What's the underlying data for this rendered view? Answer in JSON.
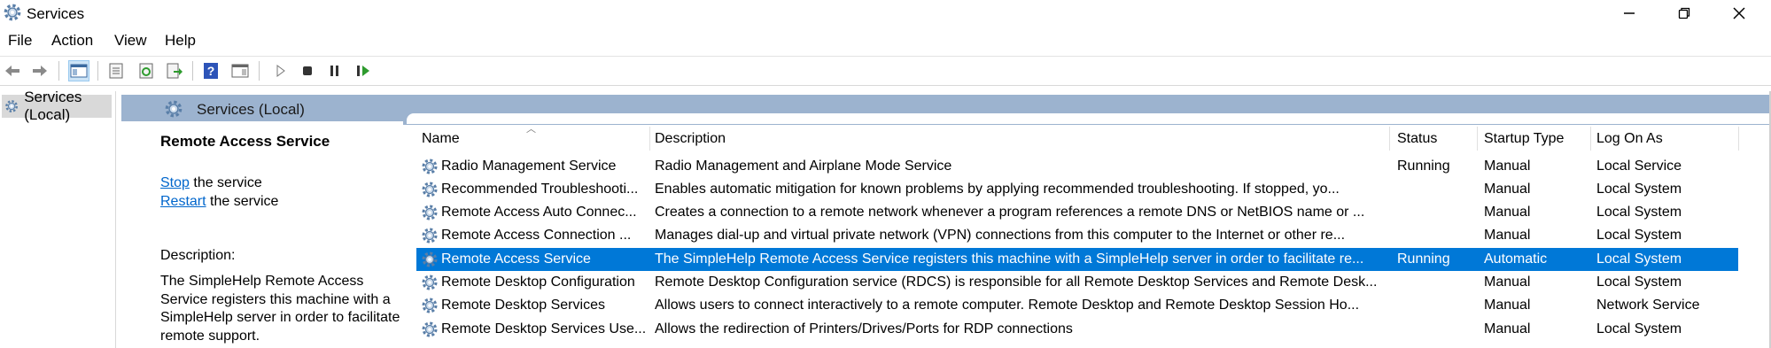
{
  "window": {
    "title": "Services",
    "icon": "services-gear-icon",
    "controls": [
      "minimize-icon",
      "restore-icon",
      "close-icon"
    ]
  },
  "menu": [
    "File",
    "Action",
    "View",
    "Help"
  ],
  "toolbar": {
    "buttons": [
      "back-arrow-icon",
      "forward-arrow-icon",
      "show-hide-console-tree-icon",
      "properties-icon",
      "refresh-icon",
      "export-list-icon",
      "help-icon",
      "show-hide-action-pane-icon",
      "start-service-icon",
      "stop-service-icon",
      "pause-service-icon",
      "resume-service-icon"
    ]
  },
  "tree": {
    "root_label": "Services (Local)"
  },
  "content": {
    "header": "Services (Local)",
    "detail": {
      "service_name": "Remote Access Service",
      "stop_link": "Stop",
      "stop_suffix": " the service",
      "restart_link": "Restart",
      "restart_suffix": " the service",
      "description_label": "Description:",
      "description_text": "The SimpleHelp Remote Access Service registers this machine with a SimpleHelp server in order to facilitate remote support."
    },
    "columns": {
      "name": "Name",
      "description": "Description",
      "status": "Status",
      "startup_type": "Startup Type",
      "log_on_as": "Log On As"
    },
    "rows": [
      {
        "name": "Radio Management Service",
        "description": "Radio Management and Airplane Mode Service",
        "status": "Running",
        "startup": "Manual",
        "logon": "Local Service"
      },
      {
        "name": "Recommended Troubleshooti...",
        "description": "Enables automatic mitigation for known problems by applying recommended troubleshooting. If stopped, yo...",
        "status": "",
        "startup": "Manual",
        "logon": "Local System"
      },
      {
        "name": "Remote Access Auto Connec...",
        "description": "Creates a connection to a remote network whenever a program references a remote DNS or NetBIOS name or ...",
        "status": "",
        "startup": "Manual",
        "logon": "Local System"
      },
      {
        "name": "Remote Access Connection ...",
        "description": "Manages dial-up and virtual private network (VPN) connections from this computer to the Internet or other re...",
        "status": "",
        "startup": "Manual",
        "logon": "Local System"
      },
      {
        "name": "Remote Access Service",
        "description": "The SimpleHelp Remote Access Service registers this machine with a SimpleHelp server in order to facilitate re...",
        "status": "Running",
        "startup": "Automatic",
        "logon": "Local System"
      },
      {
        "name": "Remote Desktop Configuration",
        "description": "Remote Desktop Configuration service (RDCS) is responsible for all Remote Desktop Services and Remote Desk...",
        "status": "",
        "startup": "Manual",
        "logon": "Local System"
      },
      {
        "name": "Remote Desktop Services",
        "description": "Allows users to connect interactively to a remote computer. Remote Desktop and Remote Desktop Session Ho...",
        "status": "",
        "startup": "Manual",
        "logon": "Network Service"
      },
      {
        "name": "Remote Desktop Services Use...",
        "description": "Allows the redirection of Printers/Drives/Ports for RDP connections",
        "status": "",
        "startup": "Manual",
        "logon": "Local System"
      }
    ],
    "selected_row": 4
  },
  "colors": {
    "selection": "#0078d7",
    "header_band": "#9cb3cf",
    "link": "#0066cc"
  }
}
